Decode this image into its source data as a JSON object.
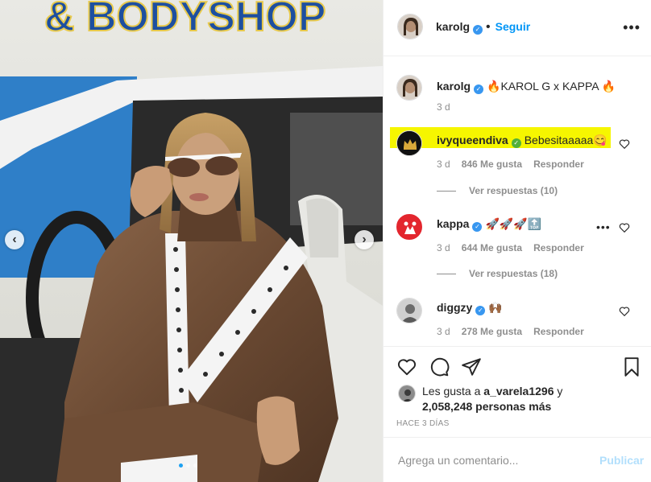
{
  "photo": {
    "sign_text": "& BODYSHOP"
  },
  "header": {
    "username": "karolg",
    "follow_label": "Seguir",
    "more_icon": "more-horizontal-icon"
  },
  "caption": {
    "username": "karolg",
    "text": "🔥KAROL G x KAPPA 🔥",
    "time": "3 d"
  },
  "comments": [
    {
      "username": "ivyqueendiva",
      "text": "Bebesitaaaaa😋",
      "time": "3 d",
      "likes": "846 Me gusta",
      "reply_label": "Responder",
      "view_replies": "Ver respuestas (10)",
      "highlight_color": "#f6f600"
    },
    {
      "username": "kappa",
      "text": "🚀🚀🚀🔝",
      "time": "3 d",
      "likes": "644 Me gusta",
      "reply_label": "Responder",
      "view_replies": "Ver respuestas (18)"
    },
    {
      "username": "diggzy",
      "text": "🙌🏾",
      "time": "3 d",
      "likes": "278 Me gusta",
      "reply_label": "Responder"
    }
  ],
  "likes": {
    "prefix": "Les gusta a",
    "user": "a_varela1296",
    "conj": "y",
    "count": "2,058,248 personas más"
  },
  "posted_ago": "HACE 3 DÍAS",
  "comment_box": {
    "placeholder": "Agrega un comentario...",
    "post_label": "Publicar"
  },
  "colors": {
    "link_blue": "#0095f6",
    "verified_blue": "#3897f0",
    "highlight_yellow": "#f6f600"
  }
}
